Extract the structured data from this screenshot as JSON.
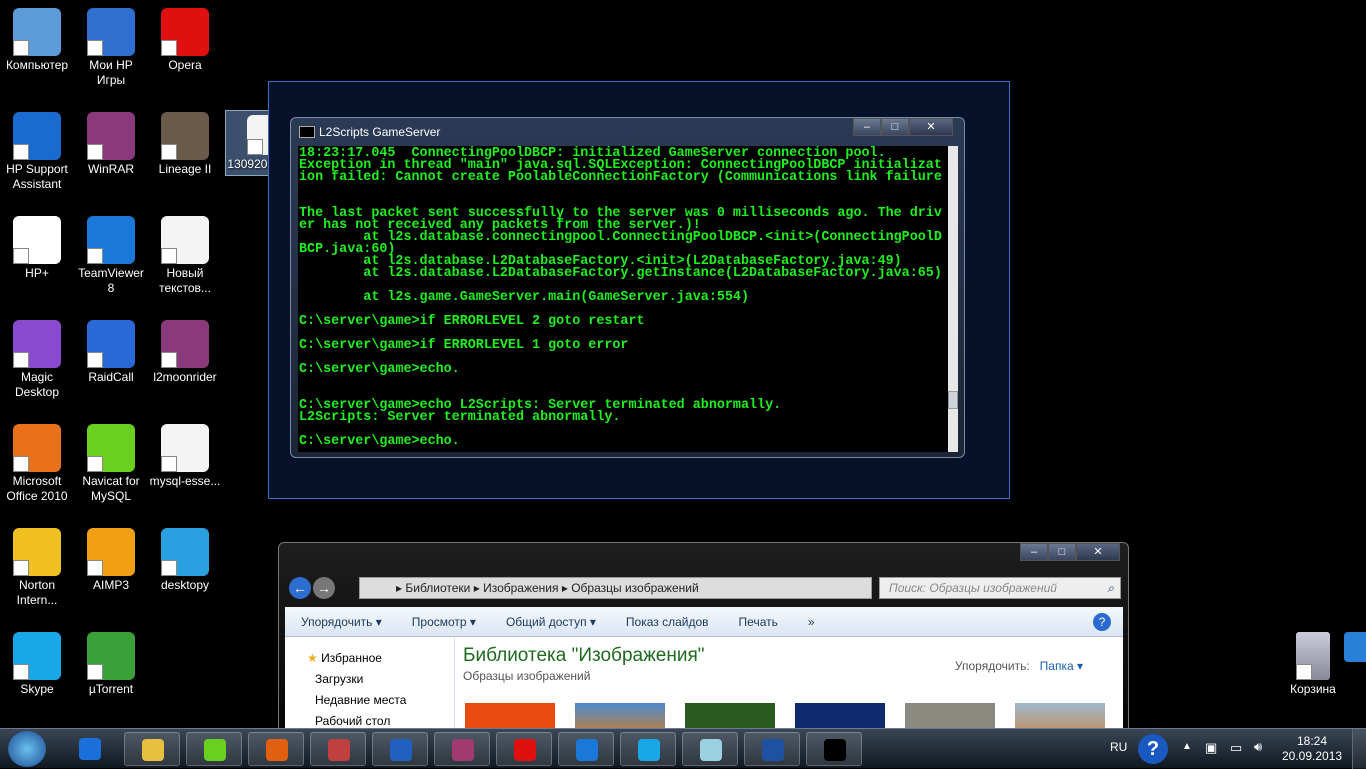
{
  "desktop_icons": [
    {
      "label": "Компьютер",
      "color": "#5a9bd8"
    },
    {
      "label": "Мои HP Игры",
      "color": "#2e6fd0"
    },
    {
      "label": "Opera",
      "color": "#e01010"
    },
    {
      "label": "HP Support Assistant",
      "color": "#1a6ad0"
    },
    {
      "label": "WinRAR",
      "color": "#8a3a7a"
    },
    {
      "label": "Lineage II",
      "color": "#6a5a4a"
    },
    {
      "label": "HP+",
      "color": "#ffffff"
    },
    {
      "label": "TeamViewer 8",
      "color": "#1a78d8"
    },
    {
      "label": "Новый текстов...",
      "color": "#f4f4f4"
    },
    {
      "label": "Magic Desktop",
      "color": "#8a4ad0"
    },
    {
      "label": "RaidCall",
      "color": "#2a6ad8"
    },
    {
      "label": "l2moonrider",
      "color": "#8a3a7a"
    },
    {
      "label": "Microsoft Office 2010",
      "color": "#e8701a"
    },
    {
      "label": "Navicat for MySQL",
      "color": "#6ad020"
    },
    {
      "label": "mysql-esse...",
      "color": "#f4f4f4"
    },
    {
      "label": "Norton Intern...",
      "color": "#f0c020"
    },
    {
      "label": "AIMP3",
      "color": "#f0a010"
    },
    {
      "label": "desktopy",
      "color": "#2aa0e0"
    },
    {
      "label": "Skype",
      "color": "#18a8e8"
    },
    {
      "label": "µTorrent",
      "color": "#3aa03a"
    }
  ],
  "selected_file": {
    "label": "130920011..."
  },
  "recycle_bin": {
    "label": "Корзина"
  },
  "console": {
    "title": "L2Scripts GameServer",
    "lines": "18:23:17.045  ConnectingPoolDBCP: initialized GameServer connection pool.\nException in thread \"main\" java.sql.SQLException: ConnectingPoolDBCP initializat\nion failed: Cannot create PoolableConnectionFactory (Communications link failure\n\n\nThe last packet sent successfully to the server was 0 milliseconds ago. The driv\ner has not received any packets from the server.)!\n        at l2s.database.connectingpool.ConnectingPoolDBCP.<init>(ConnectingPoolD\nBCP.java:60)\n        at l2s.database.L2DatabaseFactory.<init>(L2DatabaseFactory.java:49)\n        at l2s.database.L2DatabaseFactory.getInstance(L2DatabaseFactory.java:65)\n\n        at l2s.game.GameServer.main(GameServer.java:554)\n\nC:\\server\\game>if ERRORLEVEL 2 goto restart\n\nC:\\server\\game>if ERRORLEVEL 1 goto error\n\nC:\\server\\game>echo.\n\n\nC:\\server\\game>echo L2Scripts: Server terminated abnormally.\nL2Scripts: Server terminated abnormally.\n\nC:\\server\\game>echo."
  },
  "explorer": {
    "breadcrumb": [
      "Библиотеки",
      "Изображения",
      "Образцы изображений"
    ],
    "search_placeholder": "Поиск: Образцы изображений",
    "toolbar": [
      "Упорядочить ▾",
      "Просмотр ▾",
      "Общий доступ ▾",
      "Показ слайдов",
      "Печать",
      "»"
    ],
    "nav": [
      "Избранное",
      "Загрузки",
      "Недавние места",
      "Рабочий стол"
    ],
    "library_title": "Библиотека \"Изображения\"",
    "library_subtitle": "Образцы изображений",
    "arrange_label": "Упорядочить:",
    "arrange_value": "Папка ▾"
  },
  "taskbar": {
    "lang": "RU",
    "time": "18:24",
    "date": "20.09.2013"
  }
}
